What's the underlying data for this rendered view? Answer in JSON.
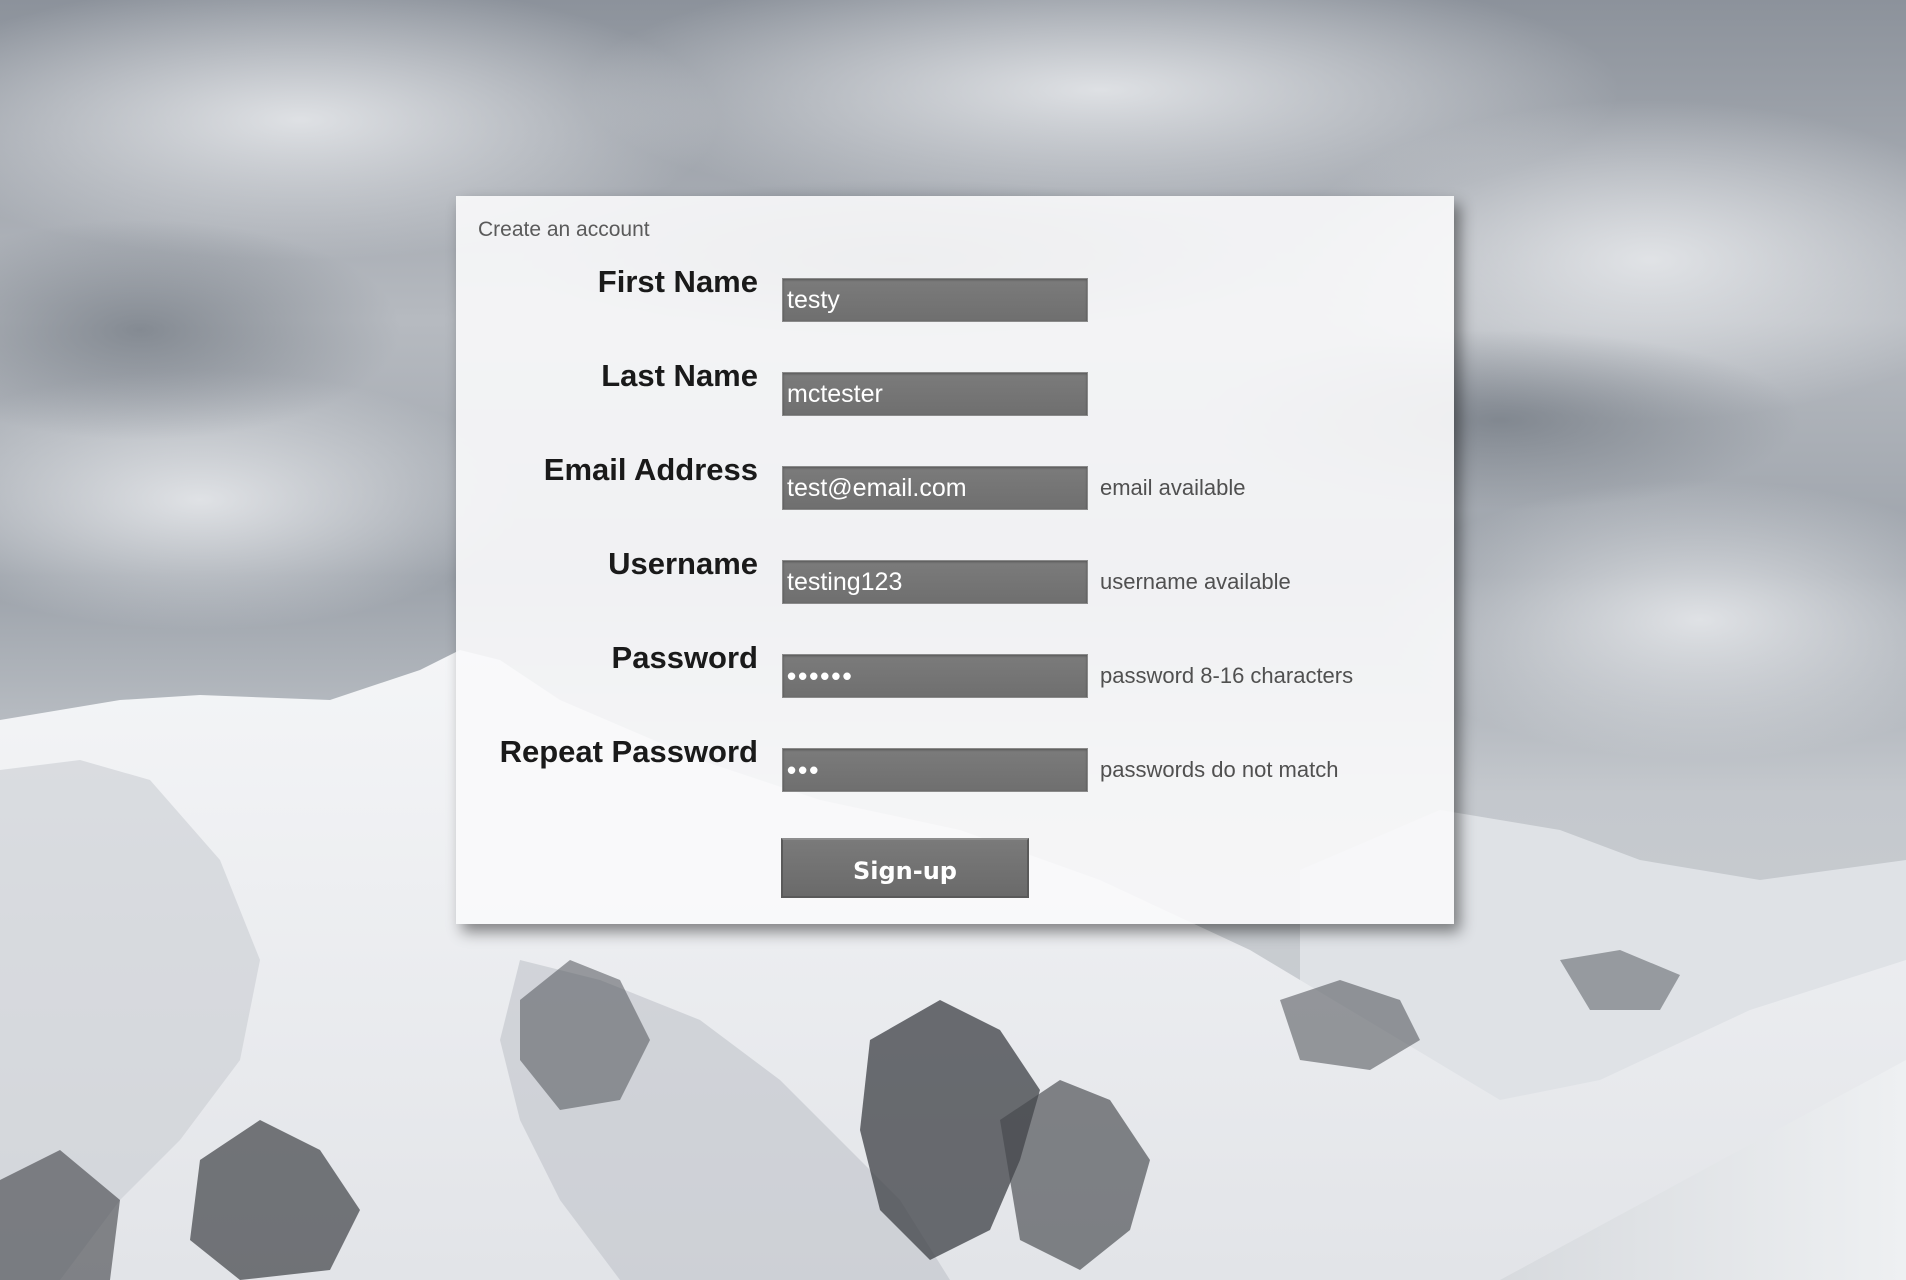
{
  "form": {
    "title": "Create an account",
    "fields": [
      {
        "label": "First Name",
        "value": "testy",
        "type": "text",
        "hint": ""
      },
      {
        "label": "Last Name",
        "value": "mctester",
        "type": "text",
        "hint": ""
      },
      {
        "label": "Email Address",
        "value": "test@email.com",
        "type": "text",
        "hint": "email available"
      },
      {
        "label": "Username",
        "value": "testing123",
        "type": "text",
        "hint": "username available"
      },
      {
        "label": "Password",
        "value": "aaaaaa",
        "type": "password",
        "hint": "password 8-16 characters"
      },
      {
        "label": "Repeat Password",
        "value": "aaa",
        "type": "password",
        "hint": "passwords do not match"
      }
    ],
    "submit_label": "Sign-up"
  },
  "colors": {
    "input_bg": "#747474",
    "input_text": "#ffffff",
    "label_text": "#1a1a1a",
    "hint_text": "#505050",
    "card_bg": "#fafafb"
  },
  "background": {
    "scene": "snowy-mountains-under-cloudy-sky"
  }
}
